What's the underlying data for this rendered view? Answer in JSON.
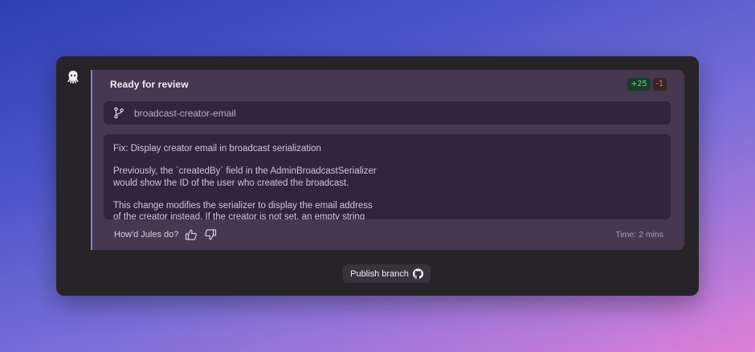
{
  "card": {
    "title": "Ready for review",
    "additions": "+25",
    "deletions": "-1",
    "branch": "broadcast-creator-email",
    "message_lines": [
      "Fix: Display creator email in broadcast serialization",
      "",
      "Previously, the `createdBy` field in the AdminBroadcastSerializer",
      "would show the ID of the user who created the broadcast.",
      "",
      "This change modifies the serializer to display the email address",
      "of the creator instead. If the creator is not set, an empty string"
    ],
    "feedback_prompt": "How'd Jules do?",
    "time": "Time: 2 mins"
  },
  "actions": {
    "publish_label": "Publish branch"
  },
  "icons": {
    "agent": "octopus-icon",
    "branch": "git-branch-icon",
    "thumbs_up": "thumbs-up-icon",
    "thumbs_down": "thumbs-down-icon",
    "github": "github-icon"
  },
  "colors": {
    "accent": "#8a78e6",
    "additions": "#5ee08a",
    "deletions": "#f06a5a"
  }
}
